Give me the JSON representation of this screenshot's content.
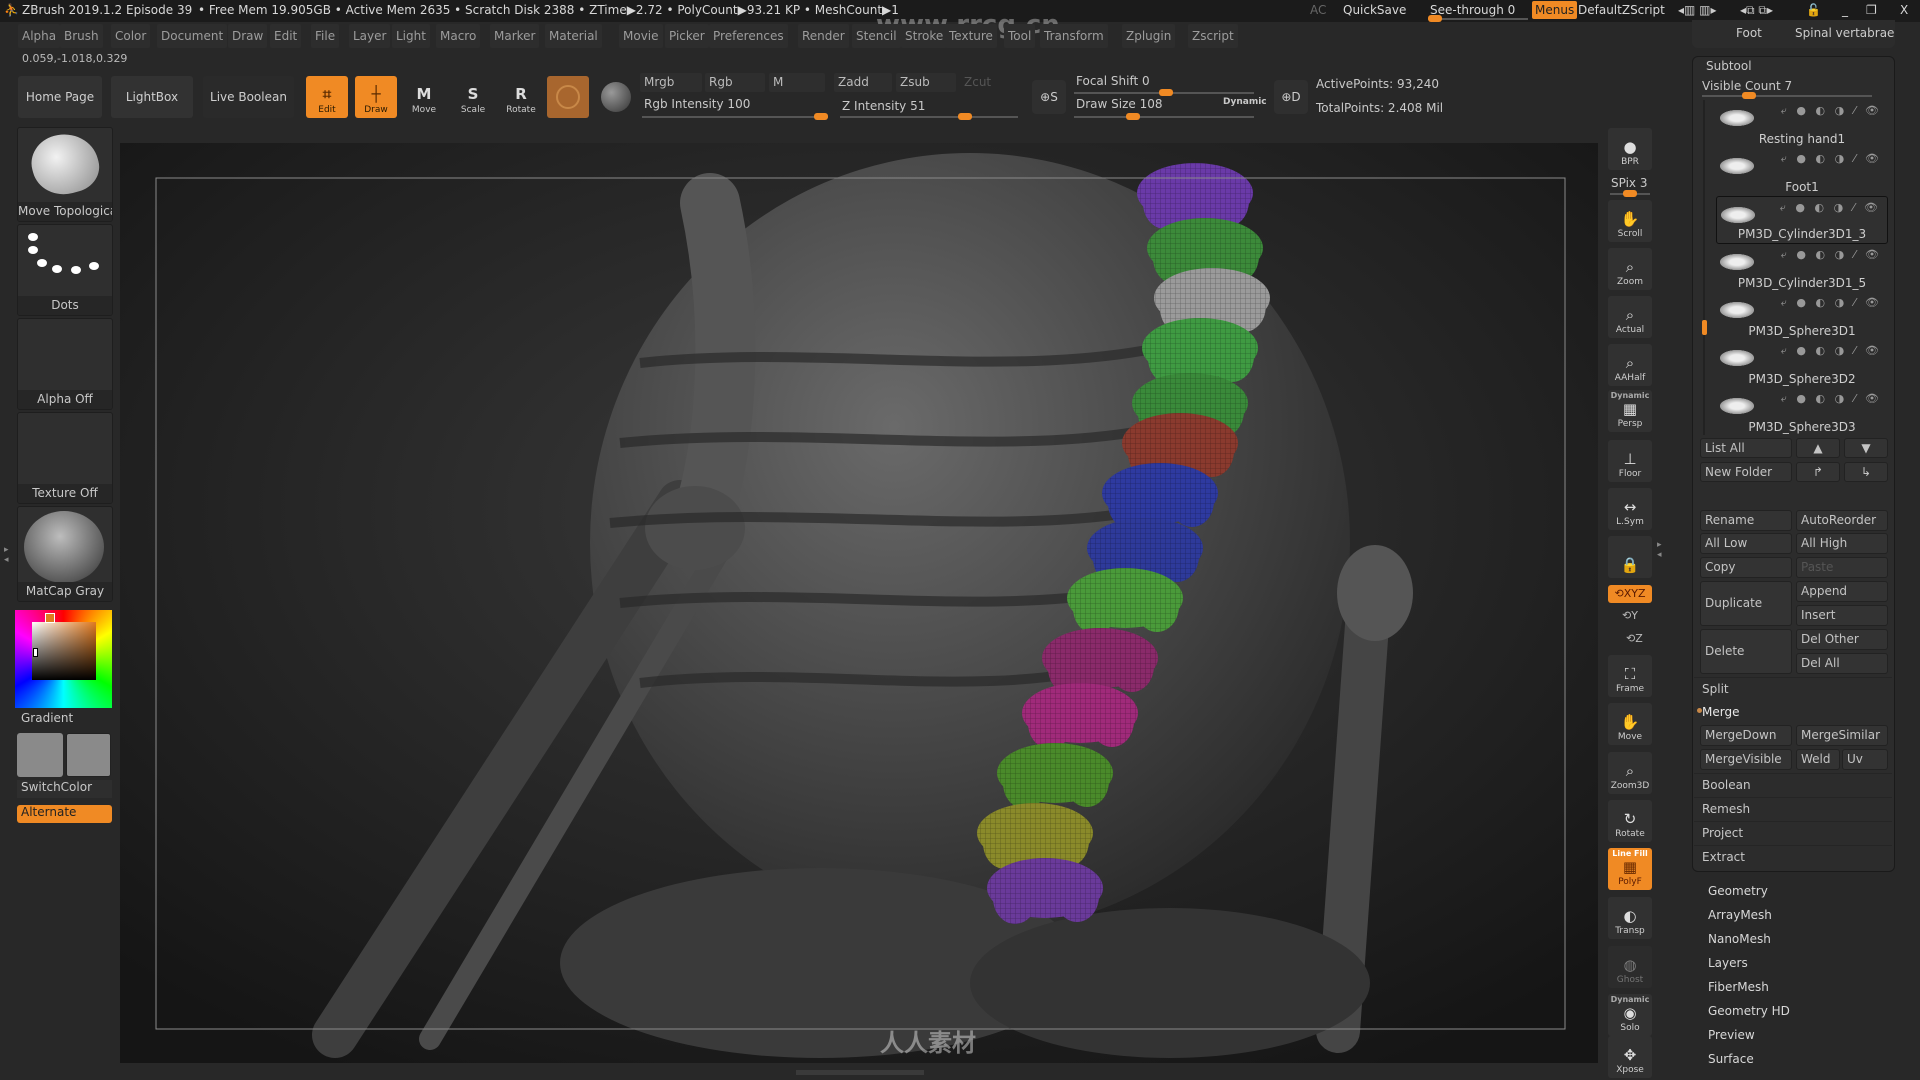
{
  "titlebar": {
    "app": "ZBrush 2019.1.2",
    "doc": "Episode 39",
    "stats": "• Free Mem 19.905GB • Active Mem 2635 • Scratch Disk 2388 • ZTime▶2.72 • PolyCount▶93.21 KP • MeshCount▶1",
    "ac": "AC",
    "quicksave": "QuickSave",
    "see_through": "See-through  0",
    "see_through_value": 0,
    "menus": "Menus",
    "script": "DefaultZScript"
  },
  "watermark": {
    "top": "www.rrcg.cn",
    "bottom": "人人素材"
  },
  "menus": [
    "Alpha",
    "Brush",
    "Color",
    "Document",
    "Draw",
    "Edit",
    "File",
    "Layer",
    "Light",
    "Macro",
    "Marker",
    "Material",
    "Movie",
    "Picker",
    "Preferences",
    "Render",
    "Stencil",
    "Stroke",
    "Texture",
    "Tool",
    "Transform",
    "Zplugin",
    "Zscript"
  ],
  "coords": "0.059,-1.018,0.329",
  "toolbar": {
    "home": "Home Page",
    "lightbox": "LightBox",
    "live_boolean": "Live Boolean",
    "edit": "Edit",
    "draw": "Draw",
    "move": "Move",
    "scale": "Scale",
    "rotate": "Rotate",
    "mrgb": "Mrgb",
    "rgb": "Rgb",
    "m": "M",
    "zadd": "Zadd",
    "zsub": "Zsub",
    "zcut": "Zcut",
    "rgb_intensity": "Rgb Intensity 100",
    "rgb_intensity_value": 100,
    "z_intensity": "Z Intensity 51",
    "z_intensity_value": 51,
    "focal_shift": "Focal Shift 0",
    "focal_shift_value": 0,
    "draw_size": "Draw Size 108",
    "draw_size_value": 108,
    "dynamic": "Dynamic",
    "active_points": "ActivePoints: 93,240",
    "total_points": "TotalPoints: 2.408 Mil"
  },
  "left_shelf": {
    "brush": "Move Topologica",
    "stroke": "Dots",
    "alpha": "Alpha Off",
    "texture": "Texture Off",
    "material": "MatCap Gray",
    "gradient": "Gradient",
    "switch_color": "SwitchColor",
    "alternate": "Alternate"
  },
  "right_shelf": [
    {
      "label": "BPR",
      "icon": "bpr-sphere-icon",
      "g": "●"
    },
    {
      "label": "Scroll",
      "icon": "scroll-hand-icon",
      "g": "✋"
    },
    {
      "label": "Zoom",
      "icon": "zoom-icon",
      "g": "⌕"
    },
    {
      "label": "Actual",
      "icon": "actual-size-icon",
      "g": "⌕"
    },
    {
      "label": "AAHalf",
      "icon": "aahalf-icon",
      "g": "⌕"
    },
    {
      "label": "Persp",
      "icon": "perspective-grid-icon",
      "g": "▦"
    },
    {
      "label": "Floor",
      "icon": "floor-icon",
      "g": "⊥"
    },
    {
      "label": "L.Sym",
      "icon": "local-symmetry-icon",
      "g": "↔"
    },
    {
      "label": "",
      "icon": "camera-lock-icon",
      "g": "🔒"
    },
    {
      "label": "Frame",
      "icon": "frame-icon",
      "g": "⛶"
    },
    {
      "label": "Move",
      "icon": "move-hand-icon",
      "g": "✋"
    },
    {
      "label": "Zoom3D",
      "icon": "zoom3d-icon",
      "g": "⌕"
    },
    {
      "label": "Rotate",
      "icon": "rotate-icon",
      "g": "↻"
    },
    {
      "label": "PolyF",
      "icon": "polyframe-icon",
      "g": "▦",
      "active": true
    },
    {
      "label": "Transp",
      "icon": "transparency-icon",
      "g": "◐"
    },
    {
      "label": "Ghost",
      "icon": "ghost-icon",
      "g": "◍"
    },
    {
      "label": "Solo",
      "icon": "solo-icon",
      "g": "◉"
    },
    {
      "label": "Xpose",
      "icon": "xpose-icon",
      "g": "✥"
    }
  ],
  "spix": "SPix 3",
  "spix_value": 3,
  "xyz": "XYZ",
  "rot_y": "Y",
  "rot_z": "Z",
  "dynamic_persp": "Dynamic",
  "dynamic_solo": "Dynamic",
  "line_fill": "Line Fill",
  "right_panel": {
    "tabs": [
      "Foot",
      "Spinal vertabrae"
    ],
    "title": "Subtool",
    "visible_count": "Visible Count 7",
    "visible_count_value": 7,
    "subtools": [
      {
        "name": "Resting hand1"
      },
      {
        "name": "Foot1"
      },
      {
        "name": "PM3D_Cylinder3D1_3",
        "selected": true
      },
      {
        "name": "PM3D_Cylinder3D1_5"
      },
      {
        "name": "PM3D_Sphere3D1"
      },
      {
        "name": "PM3D_Sphere3D2"
      },
      {
        "name": "PM3D_Sphere3D3"
      }
    ],
    "list_all": "List All",
    "new_folder": "New Folder",
    "rename": "Rename",
    "auto_reorder": "AutoReorder",
    "all_low": "All Low",
    "all_high": "All High",
    "copy": "Copy",
    "paste": "Paste",
    "duplicate": "Duplicate",
    "append": "Append",
    "insert": "Insert",
    "delete": "Delete",
    "del_other": "Del Other",
    "del_all": "Del All",
    "split": "Split",
    "merge": "Merge",
    "merge_down": "MergeDown",
    "merge_similar": "MergeSimilar",
    "merge_visible": "MergeVisible",
    "weld": "Weld",
    "uv": "Uv",
    "sections": [
      "Boolean",
      "Remesh",
      "Project",
      "Extract"
    ],
    "tool_menus": [
      "Geometry",
      "ArrayMesh",
      "NanoMesh",
      "Layers",
      "FiberMesh",
      "Geometry HD",
      "Preview",
      "Surface"
    ]
  },
  "colors": {
    "accent": "#f08a24",
    "vertebrae": [
      "#6a3aa8",
      "#3c8a3a",
      "#9a9a9a",
      "#3f9a42",
      "#3a8a3a",
      "#8a3a2e",
      "#2e3aa0",
      "#2e3a9a",
      "#4a9a3a",
      "#8a2a6a",
      "#a02a7a",
      "#4a8a2a",
      "#8a8a2a",
      "#6a3a9a"
    ]
  }
}
